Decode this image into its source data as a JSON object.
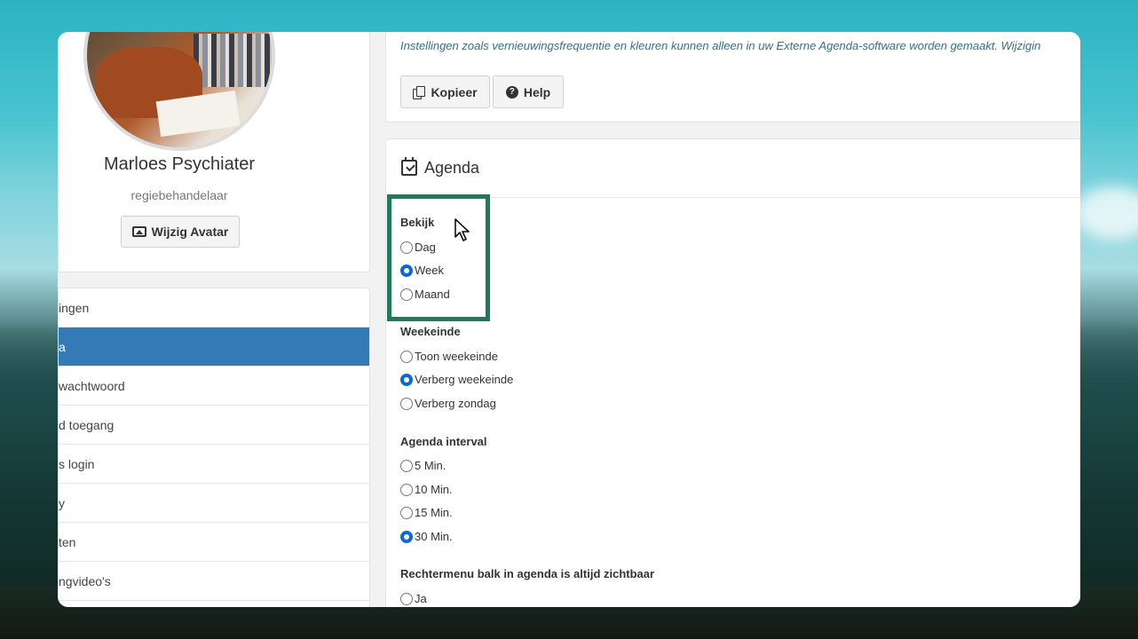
{
  "profile": {
    "name": "Marloes Psychiater",
    "role": "regiebehandelaar",
    "avatar_button": "Wijzig Avatar"
  },
  "nav": {
    "items": [
      {
        "label": "ingen",
        "active": false
      },
      {
        "label": "a",
        "active": true
      },
      {
        "label": "wachtwoord",
        "active": false
      },
      {
        "label": "d toegang",
        "active": false
      },
      {
        "label": "s login",
        "active": false
      },
      {
        "label": "y",
        "active": false
      },
      {
        "label": "ten",
        "active": false
      },
      {
        "label": "ngvideo's",
        "active": false
      }
    ]
  },
  "top": {
    "info_text": "Instellingen zoals vernieuwingsfrequentie en kleuren kunnen alleen in uw Externe Agenda-software worden gemaakt. Wijzigin",
    "copy_button": "Kopieer",
    "help_button": "Help"
  },
  "agenda": {
    "title": "Agenda",
    "groups": [
      {
        "label": "Bekijk",
        "options": [
          {
            "label": "Dag",
            "checked": false
          },
          {
            "label": "Week",
            "checked": true
          },
          {
            "label": "Maand",
            "checked": false
          }
        ]
      },
      {
        "label": "Weekeinde",
        "options": [
          {
            "label": "Toon weekeinde",
            "checked": false
          },
          {
            "label": "Verberg weekeinde",
            "checked": true
          },
          {
            "label": "Verberg zondag",
            "checked": false
          }
        ]
      },
      {
        "label": "Agenda interval",
        "options": [
          {
            "label": "5 Min.",
            "checked": false
          },
          {
            "label": "10 Min.",
            "checked": false
          },
          {
            "label": "15 Min.",
            "checked": false
          },
          {
            "label": "30 Min.",
            "checked": true
          }
        ]
      },
      {
        "label": "Rechtermenu balk in agenda is altijd zichtbaar",
        "options": [
          {
            "label": "Ja",
            "checked": false
          }
        ]
      }
    ]
  },
  "colors": {
    "active_nav": "#337ab7",
    "highlight_border": "#1f7a5a",
    "info_text": "#31708f"
  }
}
